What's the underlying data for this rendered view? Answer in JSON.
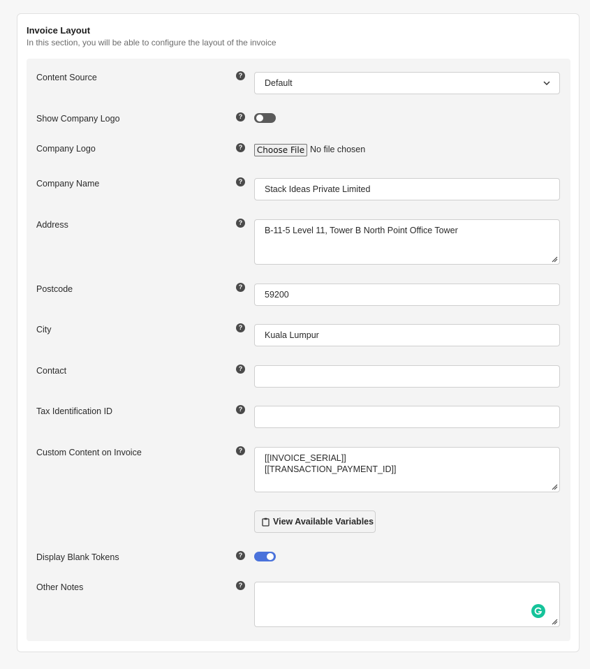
{
  "header": {
    "title": "Invoice Layout",
    "description": "In this section, you will be able to configure the layout of the invoice"
  },
  "fields": {
    "content_source": {
      "label": "Content Source",
      "value": "Default"
    },
    "show_company_logo": {
      "label": "Show Company Logo",
      "enabled": false
    },
    "company_logo": {
      "label": "Company Logo",
      "button": "Choose File",
      "status": "No file chosen"
    },
    "company_name": {
      "label": "Company Name",
      "value": "Stack Ideas Private Limited"
    },
    "address": {
      "label": "Address",
      "value": "B-11-5 Level 11, Tower B North Point Office Tower"
    },
    "postcode": {
      "label": "Postcode",
      "value": "59200"
    },
    "city": {
      "label": "City",
      "value": "Kuala Lumpur"
    },
    "contact": {
      "label": "Contact",
      "value": ""
    },
    "tax_id": {
      "label": "Tax Identification ID",
      "value": ""
    },
    "custom_content": {
      "label": "Custom Content on Invoice",
      "line1": "[[INVOICE_SERIAL]]",
      "line2": "[[TRANSACTION_PAYMENT_ID]]",
      "button": "View Available Variables"
    },
    "display_blank_tokens": {
      "label": "Display Blank Tokens",
      "enabled": true
    },
    "other_notes": {
      "label": "Other Notes",
      "value": ""
    }
  },
  "help_glyph": "?",
  "icons": {
    "help": "question-circle-icon",
    "select": "chevron-down-icon",
    "variables": "clipboard-icon",
    "grammarly": "grammarly-icon"
  },
  "colors": {
    "toggle_on": "#4a72db",
    "toggle_off": "#5a5a5a",
    "grammarly": "#15c39a"
  }
}
